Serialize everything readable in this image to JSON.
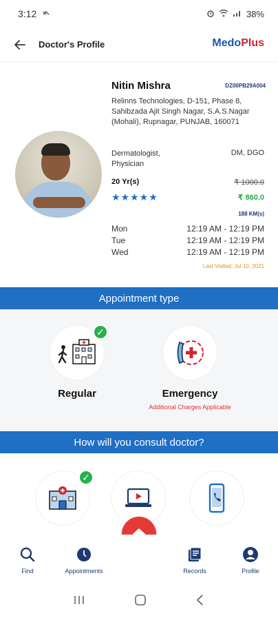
{
  "status_bar": {
    "time": "3:12",
    "battery": "38%"
  },
  "header": {
    "title": "Doctor's Profile",
    "brand_part1": "Medo",
    "brand_part2": "Plus"
  },
  "doctor": {
    "name": "Nitin Mishra",
    "id": "DZ00PB29A004",
    "address": "Relinns Technologies, D-151, Phase 8, Sahibzada Ajit Singh Nagar, S.A.S.Nagar (Mohali), Rupnagar, PUNJAB, 160071",
    "specialization_line1": "Dermatologist,",
    "specialization_line2": "Physician",
    "qualification": "DM, DGO",
    "experience": "20 Yr(s)",
    "old_fee": "₹ 1000.0",
    "new_fee": "₹ 860.0",
    "stars": "★★★★★",
    "rating": 5,
    "distance": "188 KM(s)",
    "schedule": [
      {
        "day": "Mon",
        "time": "12:19 AM - 12:19 PM"
      },
      {
        "day": "Tue",
        "time": "12:19 AM - 12:19 PM"
      },
      {
        "day": "Wed",
        "time": "12:19 AM - 12:19 PM"
      }
    ],
    "last_visited": "Last Visited: Jul 10, 2021"
  },
  "appointment_type": {
    "heading": "Appointment type",
    "options": [
      {
        "label": "Regular",
        "icon": "hospital-walk-icon",
        "selected": true
      },
      {
        "label": "Emergency",
        "icon": "emergency-phone-icon",
        "selected": false,
        "note": "Additional Charges Applicable"
      }
    ]
  },
  "consult": {
    "heading": "How will you consult doctor?",
    "options": [
      {
        "icon": "clinic-visit-icon",
        "selected": true
      },
      {
        "icon": "video-consult-icon",
        "selected": false
      },
      {
        "icon": "phone-consult-icon",
        "selected": false
      }
    ]
  },
  "bottom_nav": {
    "find": "Find",
    "appointments": "Appointments",
    "records": "Records",
    "profile": "Profile"
  },
  "colors": {
    "primary_blue": "#1f6fc4",
    "brand_red": "#d3262c",
    "fab_red": "#e43a36",
    "success_green": "#27b14a",
    "accent_orange": "#f08a1c"
  }
}
